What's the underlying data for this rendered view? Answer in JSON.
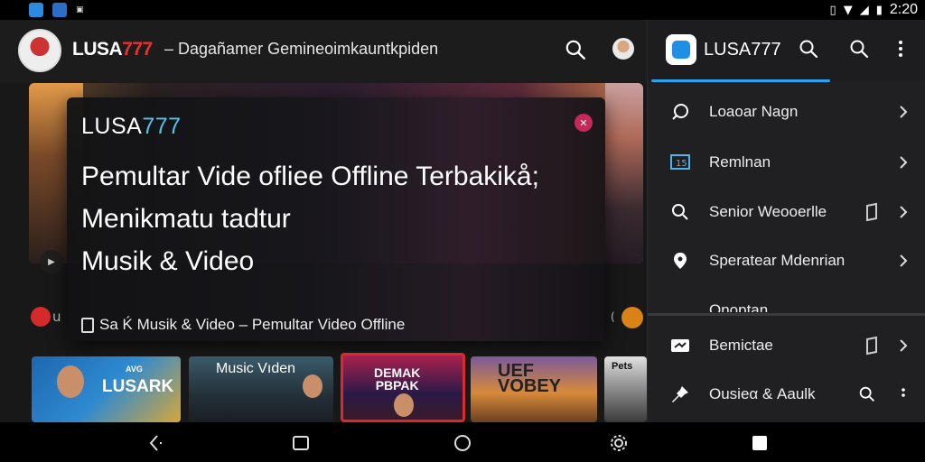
{
  "status_bar": {
    "time": "2:20",
    "left_icons": [
      "app-notification-icon",
      "app-notification-icon",
      "small-notification-icon"
    ],
    "right_icons": [
      "vibrate-icon",
      "wifi-icon",
      "signal-icon",
      "battery-icon"
    ]
  },
  "header": {
    "brand_white": "LUSA",
    "brand_red": "777",
    "subtitle": "– Dagañamer Gemineoimkauntkpiden"
  },
  "hero_card": {
    "brand_white": "LUSA",
    "brand_cyan": "777",
    "title_lines": [
      "Pemultar Vide ofliee Offline Terbakikå;",
      "Menikmatu tadtur",
      "Musik & Video"
    ],
    "footer": "Sa Ḱ Musik & Video – Pemultar Video Offline"
  },
  "thumbnails": [
    {
      "label": "LUSARK",
      "sub": "AVG"
    },
    {
      "label": "Music Vıden"
    },
    {
      "label": "DEMAK\nPBPAK"
    },
    {
      "label": "UEF\nVOBEY"
    },
    {
      "label": "Pets"
    }
  ],
  "drawer": {
    "title": "LUSA777",
    "items": [
      {
        "label": "Loaoar Nagn",
        "icon": "chat-bubble-icon"
      },
      {
        "label": "Remlnan",
        "icon": "screen-icon"
      },
      {
        "label": "Senior Weooerlle",
        "icon": "search-icon"
      },
      {
        "label": "Speratear Mdenrian",
        "icon": "location-pin-icon"
      },
      {
        "label": "Onoptan",
        "icon": "options-icon"
      },
      {
        "label": "Bemictae",
        "icon": "scissors-icon"
      },
      {
        "label": "Ousieα & Aaulk",
        "icon": "pin-icon"
      }
    ]
  },
  "colors": {
    "brand_red": "#e8312e",
    "brand_cyan": "#52c5e6",
    "accent_blue": "#2ba3ea",
    "close_pink": "#c42a58"
  }
}
